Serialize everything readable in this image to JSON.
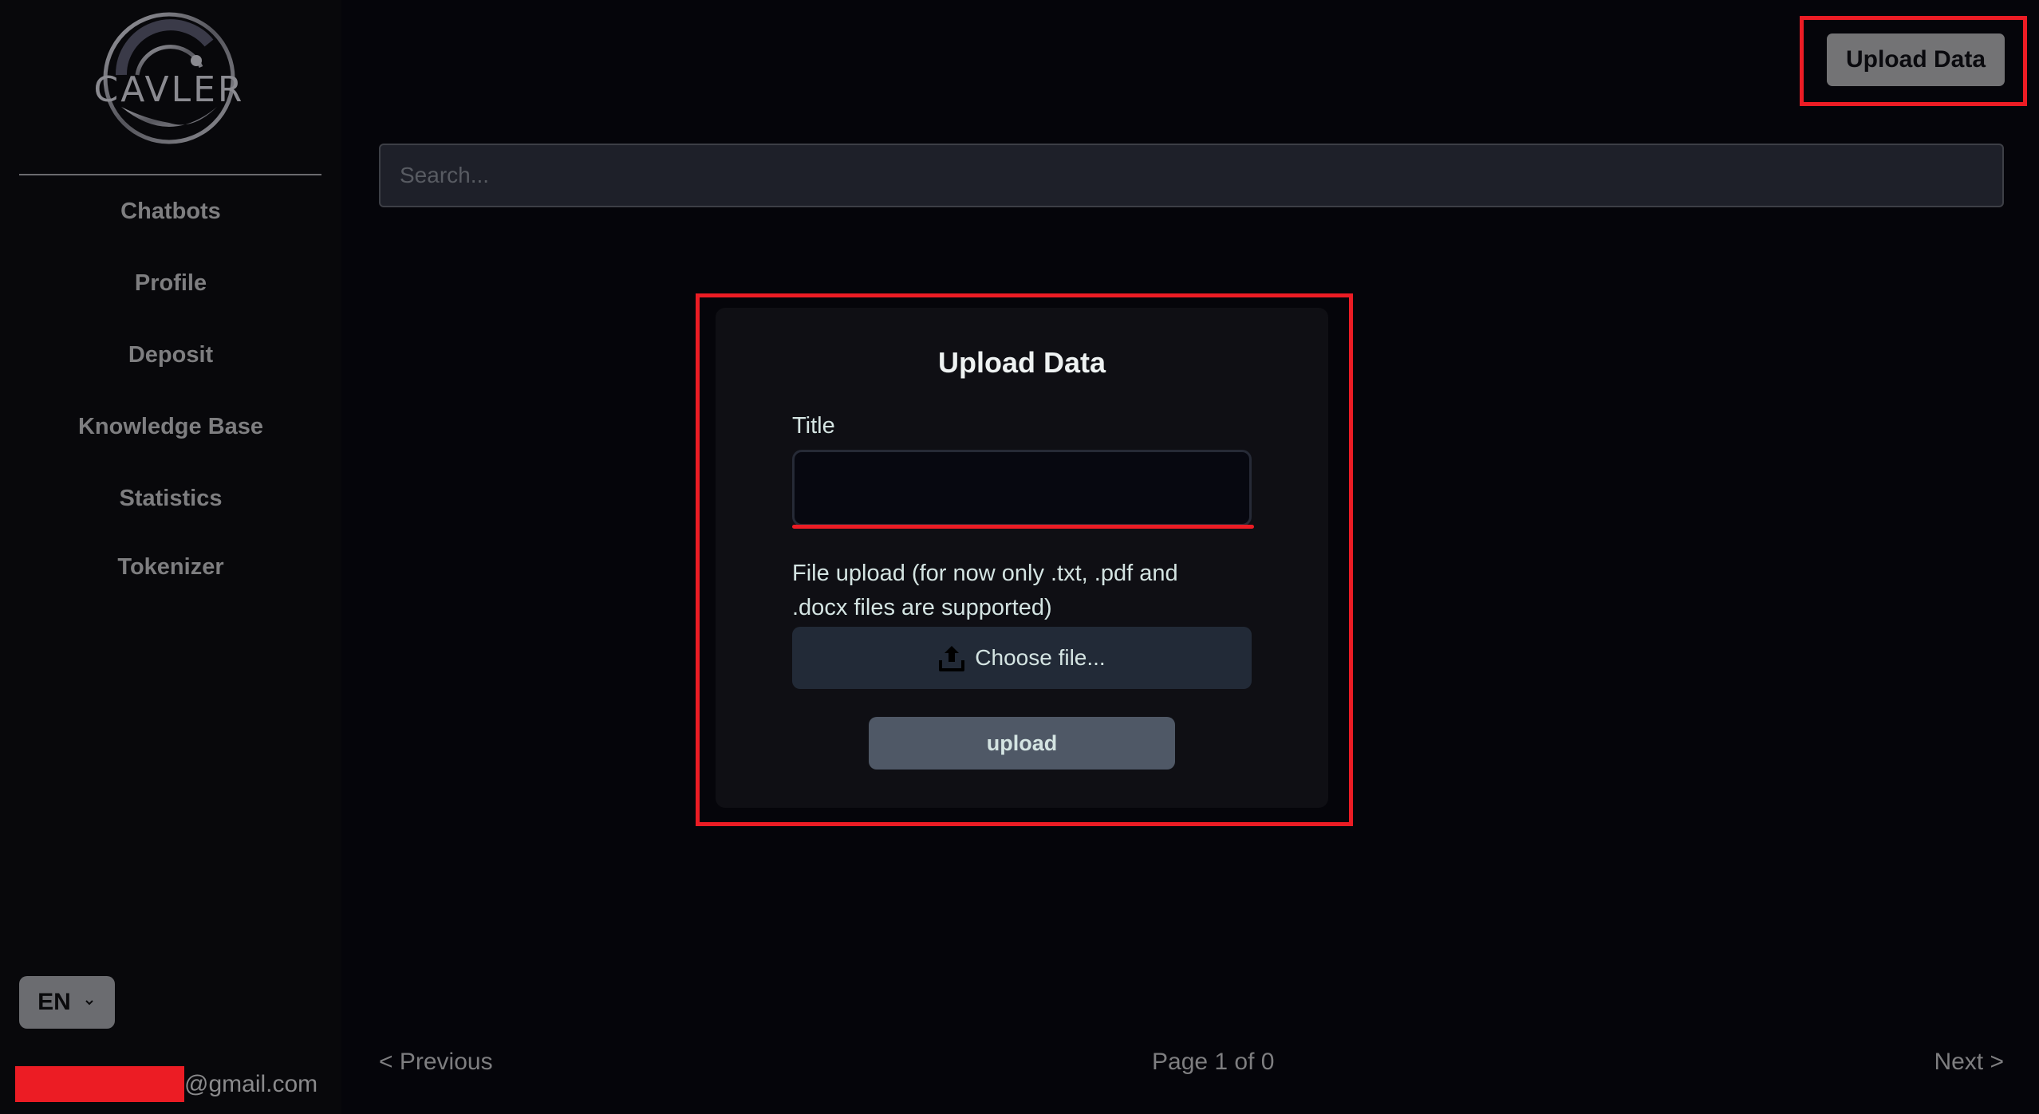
{
  "sidebar": {
    "logo_text": "CAVLER",
    "items": [
      {
        "label": "Chatbots"
      },
      {
        "label": "Profile"
      },
      {
        "label": "Deposit"
      },
      {
        "label": "Knowledge Base"
      },
      {
        "label": "Statistics"
      },
      {
        "label": "Tokenizer"
      }
    ],
    "language": {
      "selected": "EN",
      "icon": "chevron-down-icon"
    },
    "user_email_suffix": "@gmail.com"
  },
  "header": {
    "upload_data_label": "Upload Data"
  },
  "search": {
    "placeholder": "Search...",
    "value": ""
  },
  "modal": {
    "title": "Upload Data",
    "title_field": {
      "label": "Title",
      "value": ""
    },
    "file_field": {
      "label": "File upload (for now only .txt, .pdf and .docx files are supported)",
      "button_label": "Choose file...",
      "icon": "upload-icon"
    },
    "submit_label": "upload"
  },
  "pagination": {
    "previous_label": "< Previous",
    "status": "Page 1 of 0",
    "current_page": 1,
    "total_pages": 0,
    "next_label": "Next >"
  },
  "colors": {
    "annotation_red": "#ec1c24",
    "sidebar_bg": "#08080b",
    "main_bg": "#05050a",
    "modal_bg": "#0f0f14",
    "choose_file_bg": "#222a37",
    "upload_button_bg": "#4f5866"
  }
}
